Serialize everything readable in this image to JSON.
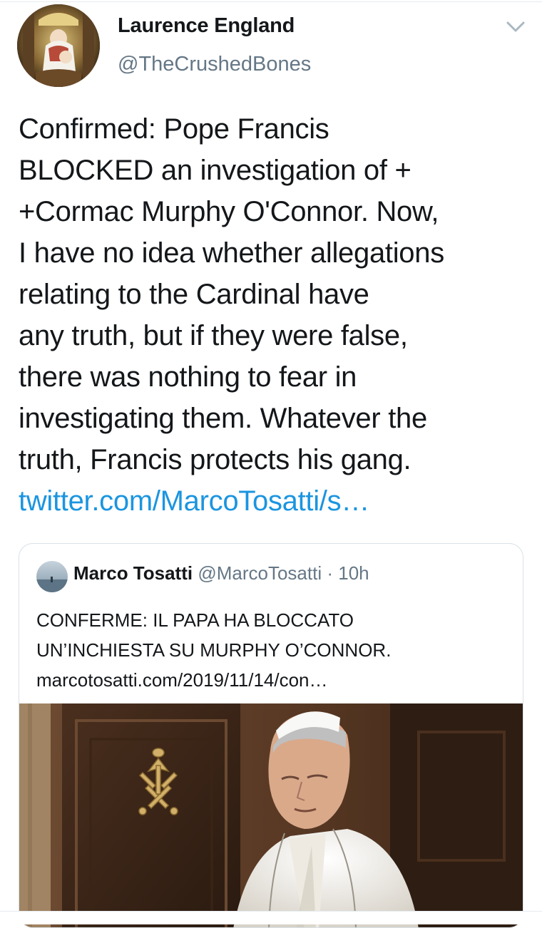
{
  "tweet": {
    "author": {
      "display_name": "Laurence England",
      "handle": "@TheCrushedBones"
    },
    "menu_icon": "chevron-down-icon",
    "text_lines": [
      "Confirmed: Pope Francis",
      "BLOCKED an investigation of +",
      "+Cormac Murphy O'Connor. Now,",
      "I have no idea whether allegations",
      "relating to the Cardinal have",
      "any truth, but if they were false,",
      "there was nothing to fear in",
      "investigating them. Whatever the",
      "truth, Francis protects his gang."
    ],
    "link_text": "twitter.com/MarcoTosatti/s…"
  },
  "quoted_tweet": {
    "display_name": "Marco Tosatti",
    "handle": "@MarcoTosatti",
    "separator": "·",
    "time": "10h",
    "text_lines": [
      "CONFERME: IL PAPA HA BLOCCATO",
      "UN’INCHIESTA SU MURPHY O’CONNOR."
    ],
    "link_text": "marcotosatti.com/2019/11/14/con…"
  },
  "colors": {
    "text": "#14171a",
    "secondary": "#657786",
    "link": "#1b95e0",
    "border": "#d9e1e7"
  }
}
